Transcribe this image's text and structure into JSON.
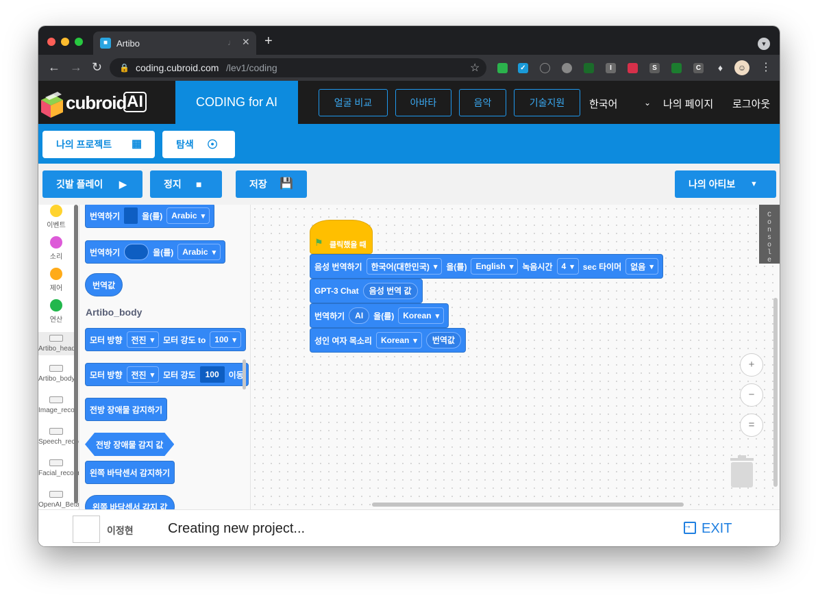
{
  "browser": {
    "tab_title": "Artibo",
    "tab_favicon": "cubroid",
    "url_host": "coding.cubroid.com",
    "url_path": "/lev1/coding",
    "new_tab": "+",
    "icons": [
      "back-icon",
      "forward-icon",
      "reload-icon",
      "lock-icon",
      "star-icon",
      "extension-icons",
      "profile-avatar",
      "menu-icon"
    ],
    "ext_letters": [
      "I",
      "S",
      "C"
    ]
  },
  "header": {
    "logo_text": "cubroid",
    "logo_ai": "AI",
    "coding_tab": "CODING for AI",
    "buttons": [
      "얼굴 비교",
      "아바타",
      "음악",
      "기술지원"
    ],
    "language": "한국어",
    "my_page": "나의 페이지",
    "logout": "로그아웃",
    "accent_color": "#0d8bde"
  },
  "subnav": {
    "my_projects": "나의 프로젝트",
    "explore": "탐색"
  },
  "toolbar": {
    "flag_play": "깃발 플레이",
    "stop": "정지",
    "save": "저장",
    "my_artibo": "나의 아티보"
  },
  "categories": [
    {
      "label": "이벤트",
      "color": "#ffd32e"
    },
    {
      "label": "소리",
      "color": "#dd5ad8"
    },
    {
      "label": "제어",
      "color": "#ffab19"
    },
    {
      "label": "연산",
      "color": "#22b74c"
    },
    {
      "label": "Artibo_head"
    },
    {
      "label": "Artibo_body"
    },
    {
      "label": "Image_recogn"
    },
    {
      "label": "Speech_recog"
    },
    {
      "label": "Facial_recogni"
    },
    {
      "label": "OpenAI_Beta"
    }
  ],
  "palette": {
    "translate1": {
      "label": "번역하기",
      "suffix": "을(를)",
      "lang": "Arabic"
    },
    "translate2": {
      "label": "번역하기",
      "suffix": "을(를)",
      "lang": "Arabic"
    },
    "translate_value": "번역값",
    "section_title": "Artibo_body",
    "motor1": {
      "label1": "모터 방향",
      "dir": "전진",
      "label2": "모터 강도 to",
      "value": "100"
    },
    "motor2": {
      "label1": "모터 방향",
      "dir": "전진",
      "label2": "모터 강도",
      "value": "100",
      "label3": "이동"
    },
    "front_detect": "전방 장애물 감지하기",
    "front_value": "전방 장애물 감지 값",
    "left_floor": "왼쪽 바닥센서 감지하기",
    "left_floor_value": "왼쪽 바닥센서 감지 값"
  },
  "script": {
    "hat": "클릭했을 때",
    "speech": {
      "label": "음성 번역하기",
      "from": "한국어(대한민국)",
      "mid": "을(를)",
      "to": "English",
      "rec_label": "녹음시간",
      "rec_value": "4",
      "sec_label": "sec 타이머",
      "timer": "없음"
    },
    "gpt": {
      "label": "GPT-3 Chat",
      "input": "음성 번역 값"
    },
    "translate": {
      "label": "번역하기",
      "input": "AI",
      "mid": "을(를)",
      "lang": "Korean"
    },
    "voice": {
      "label": "성인 여자 목소리",
      "lang": "Korean",
      "input": "번역값"
    }
  },
  "console_label": "Console",
  "zoom": {
    "in": "+",
    "out": "−",
    "reset": "="
  },
  "status": {
    "user": "이정현",
    "message": "Creating new project...",
    "exit": "EXIT"
  }
}
